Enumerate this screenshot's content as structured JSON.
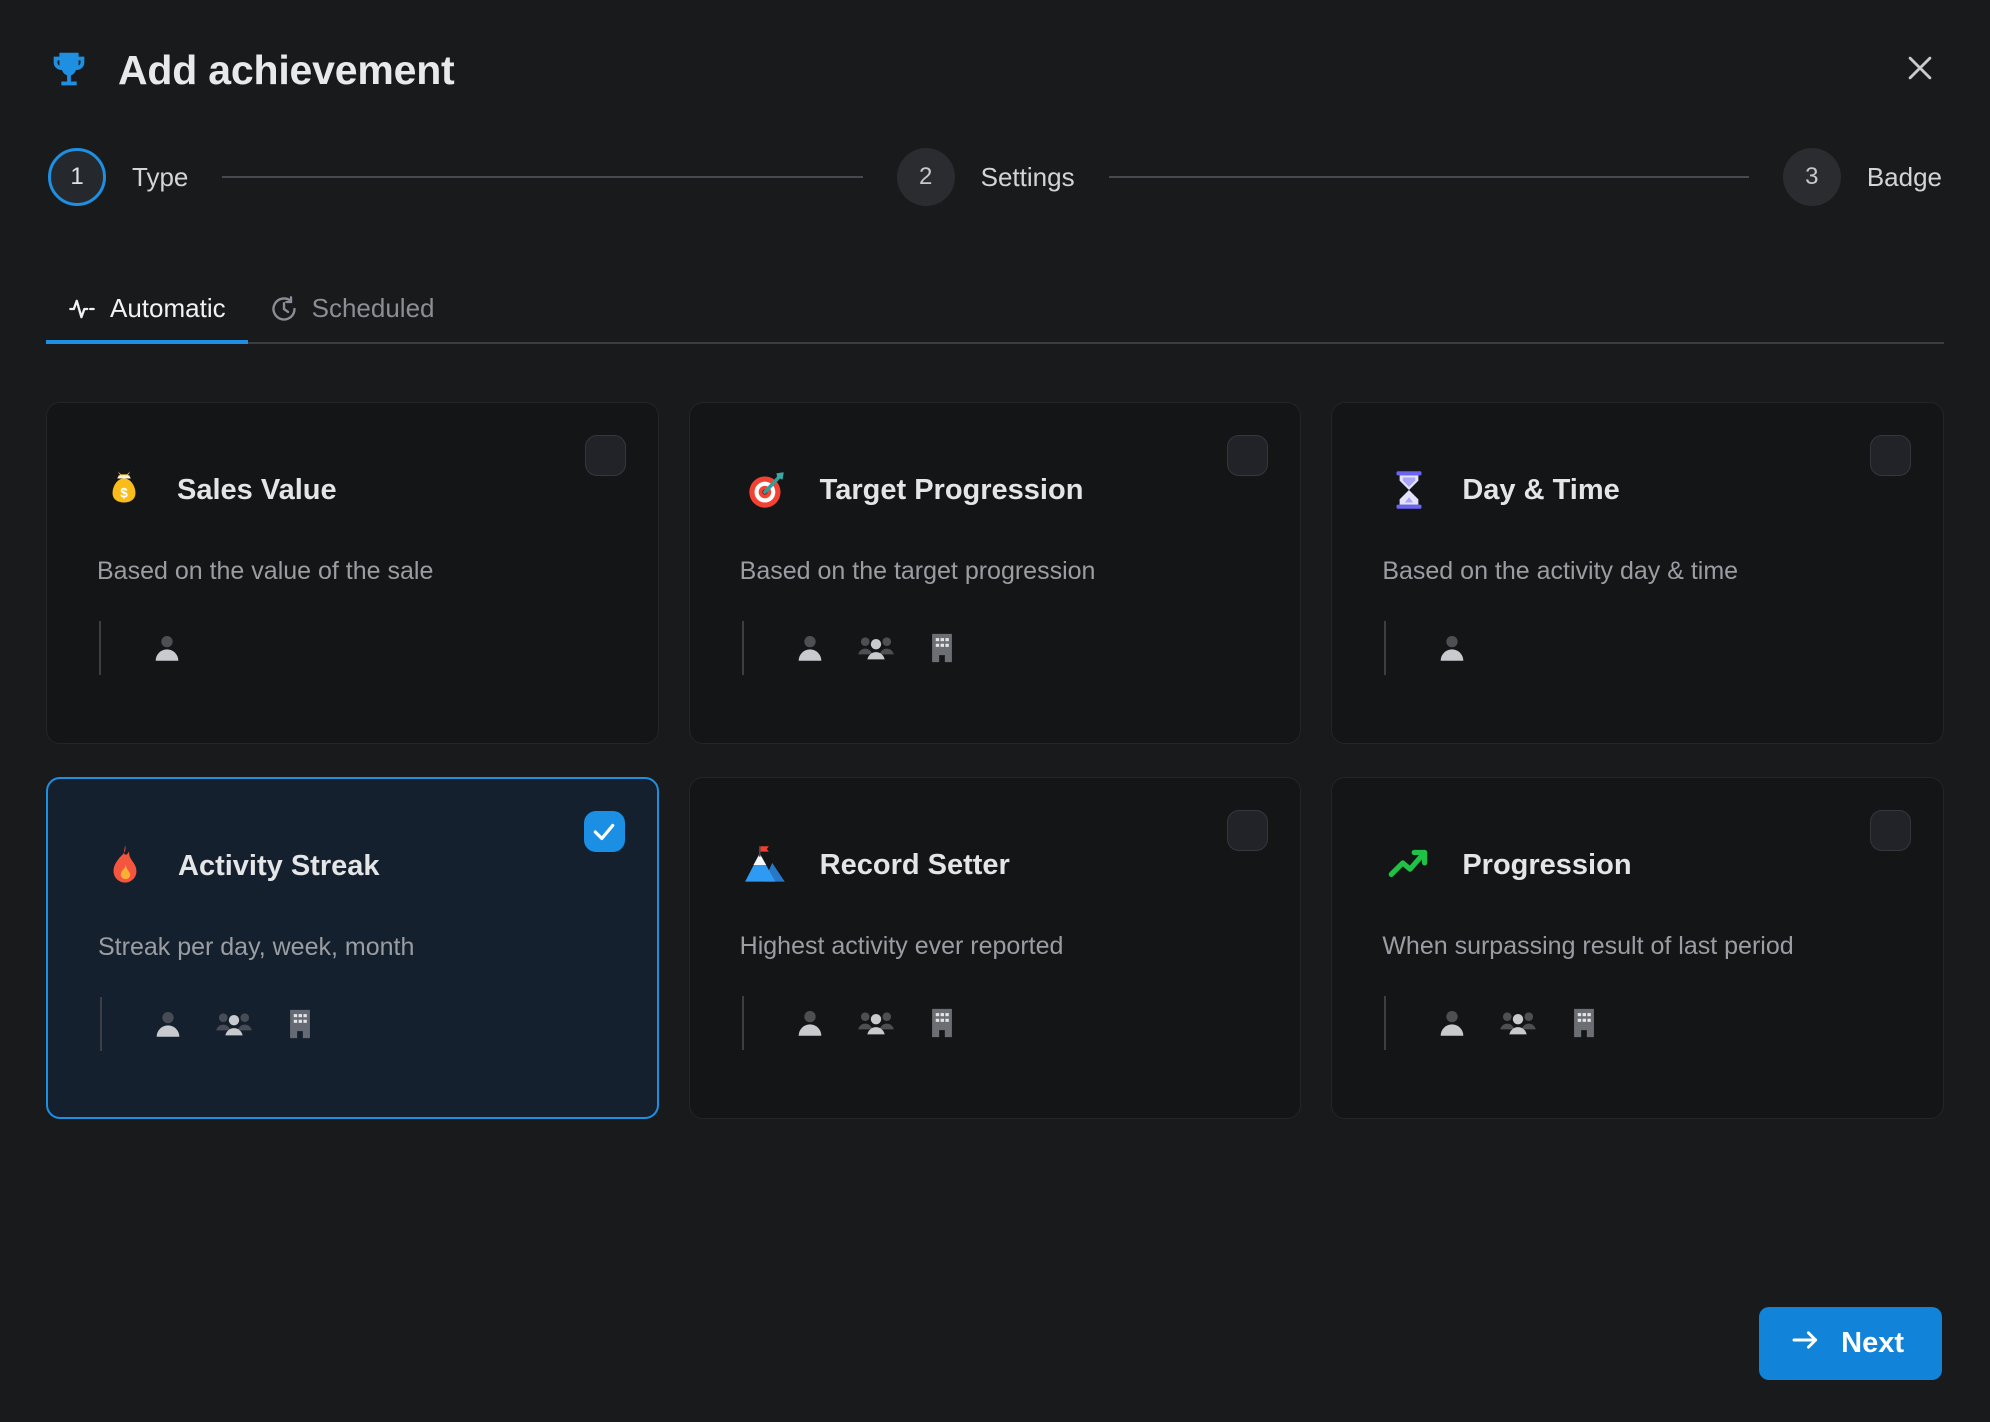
{
  "header": {
    "title": "Add achievement",
    "trophy_icon": "trophy-icon",
    "close_icon": "close-icon"
  },
  "stepper": {
    "steps": [
      {
        "number": "1",
        "label": "Type",
        "active": true
      },
      {
        "number": "2",
        "label": "Settings",
        "active": false
      },
      {
        "number": "3",
        "label": "Badge",
        "active": false
      }
    ]
  },
  "tabs": [
    {
      "label": "Automatic",
      "icon": "activity-pulse-icon",
      "active": true
    },
    {
      "label": "Scheduled",
      "icon": "timer-icon",
      "active": false
    }
  ],
  "cards": [
    {
      "title": "Sales Value",
      "description": "Based on the value of the sale",
      "emoji": "money-bag-icon",
      "selected": false,
      "scopes": [
        "person-icon"
      ]
    },
    {
      "title": "Target Progression",
      "description": "Based on the target progression",
      "emoji": "target-dart-icon",
      "selected": false,
      "scopes": [
        "person-icon",
        "group-icon",
        "building-icon"
      ]
    },
    {
      "title": "Day & Time",
      "description": "Based on the activity day & time",
      "emoji": "hourglass-icon",
      "selected": false,
      "scopes": [
        "person-icon"
      ]
    },
    {
      "title": "Activity Streak",
      "description": "Streak per day, week, month",
      "emoji": "fire-icon",
      "selected": true,
      "scopes": [
        "person-icon",
        "group-icon",
        "building-icon"
      ]
    },
    {
      "title": "Record Setter",
      "description": "Highest activity ever reported",
      "emoji": "mountain-flag-icon",
      "selected": false,
      "scopes": [
        "person-icon",
        "group-icon",
        "building-icon"
      ]
    },
    {
      "title": "Progression",
      "description": "When surpassing result of last period",
      "emoji": "trending-up-icon",
      "selected": false,
      "scopes": [
        "person-icon",
        "group-icon",
        "building-icon"
      ]
    }
  ],
  "footer": {
    "next_label": "Next",
    "next_icon": "arrow-right-icon"
  },
  "colors": {
    "accent": "#1e8fe1",
    "button": "#1183d8",
    "background": "#191a1c",
    "card": "#141517",
    "card_selected": "#15202e"
  }
}
